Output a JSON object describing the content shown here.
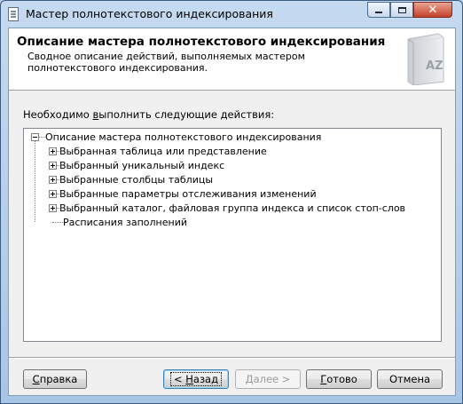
{
  "window": {
    "title": "Мастер полнотекстового индексирования"
  },
  "header": {
    "title": "Описание мастера полнотекстового индексирования",
    "description": "Сводное описание действий, выполняемых мастером полнотекстового индексирования."
  },
  "main": {
    "instruction_before": "Необходимо ",
    "instruction_accel": "в",
    "instruction_after": "ыполнить следующие действия:",
    "tree": {
      "root": {
        "label": "Описание мастера полнотекстового индексирования",
        "expanded": true
      },
      "children": [
        {
          "label": "Выбранная таблица или представление",
          "expandable": true
        },
        {
          "label": "Выбранный уникальный индекс",
          "expandable": true
        },
        {
          "label": "Выбранные столбцы таблицы",
          "expandable": true
        },
        {
          "label": "Выбранные параметры отслеживания изменений",
          "expandable": true
        },
        {
          "label": "Выбранный каталог, файловая группа индекса и список стоп-слов",
          "expandable": true
        },
        {
          "label": "Расписания заполнений",
          "expandable": false
        }
      ]
    }
  },
  "buttons": {
    "help": {
      "accel": "С",
      "rest": "правка"
    },
    "back": {
      "prefix": "< ",
      "accel": "Н",
      "rest": "азад"
    },
    "next": {
      "label": "Далее >"
    },
    "finish": {
      "accel": "Г",
      "rest": "отово"
    },
    "cancel": {
      "label": "Отмена"
    }
  },
  "icons": {
    "app": "document-icon",
    "header": "book-az-icon"
  }
}
